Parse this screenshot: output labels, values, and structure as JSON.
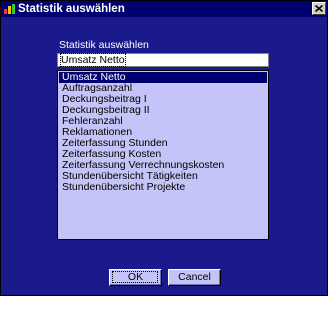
{
  "window": {
    "title": "Statistik auswählen",
    "icon": "app-icon",
    "close_icon": "close-icon"
  },
  "form": {
    "label": "Statistik auswählen",
    "value": "Umsatz Netto"
  },
  "list": {
    "items": [
      "Umsatz Netto",
      "Auftragsanzahl",
      "Deckungsbeitrag I",
      "Deckungsbeitrag II",
      "Fehleranzahl",
      "Reklamationen",
      "Zeiterfassung Stunden",
      "Zeiterfassung Kosten",
      "Zeiterfassung Verrechnungskosten",
      "Stundenübersicht Tätigkeiten",
      "Stundenübersicht Projekte"
    ],
    "selected_index": 0
  },
  "buttons": {
    "ok": "OK",
    "cancel": "Cancel"
  },
  "colors": {
    "dialog_bg": "#1a1a8c",
    "titlebar": "#000070",
    "list_bg": "#c4c4f8",
    "selection": "#000070"
  }
}
